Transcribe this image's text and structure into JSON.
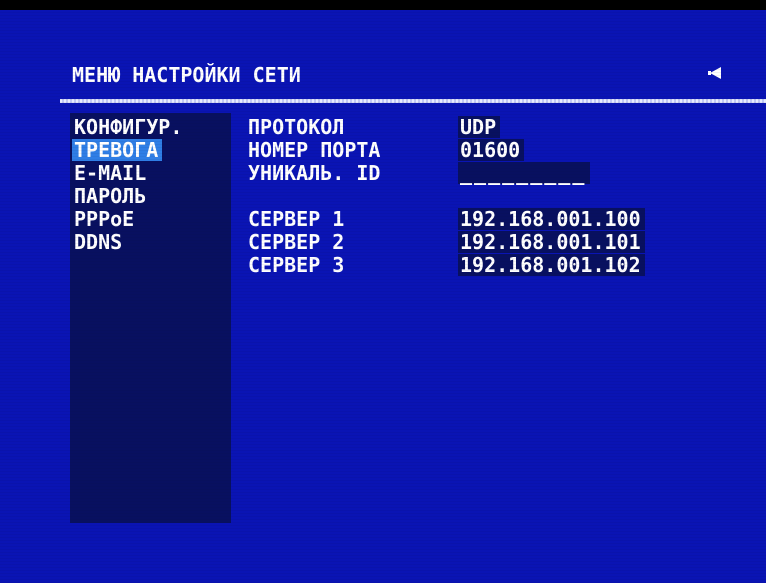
{
  "header": {
    "title": "МЕНЮ НАСТРОЙКИ СЕТИ",
    "back_icon": "back-arrow-icon"
  },
  "sidebar": {
    "items": [
      {
        "label": "КОНФИГУР.",
        "selected": false
      },
      {
        "label": "ТРЕВОГА",
        "selected": true
      },
      {
        "label": "E-MAIL",
        "selected": false
      },
      {
        "label": "ПАРОЛЬ",
        "selected": false
      },
      {
        "label": "PPPoE",
        "selected": false
      },
      {
        "label": "DDNS",
        "selected": false
      }
    ]
  },
  "settings": {
    "protocol_label": "ПРОТОКОЛ",
    "protocol_value": "UDP",
    "port_label": "НОМЕР ПОРТА",
    "port_value": "01600",
    "uid_label": "УНИКАЛЬ. ID",
    "uid_value": "_________",
    "server1_label": "СЕРВЕР 1",
    "server1_value": "192.168.001.100",
    "server2_label": "СЕРВЕР 2",
    "server2_value": "192.168.001.101",
    "server3_label": "СЕРВЕР 3",
    "server3_value": "192.168.001.102"
  },
  "colors": {
    "background": "#0a14b4",
    "panel": "#081060",
    "highlight": "#2f7ee6",
    "text": "#ffffff"
  }
}
